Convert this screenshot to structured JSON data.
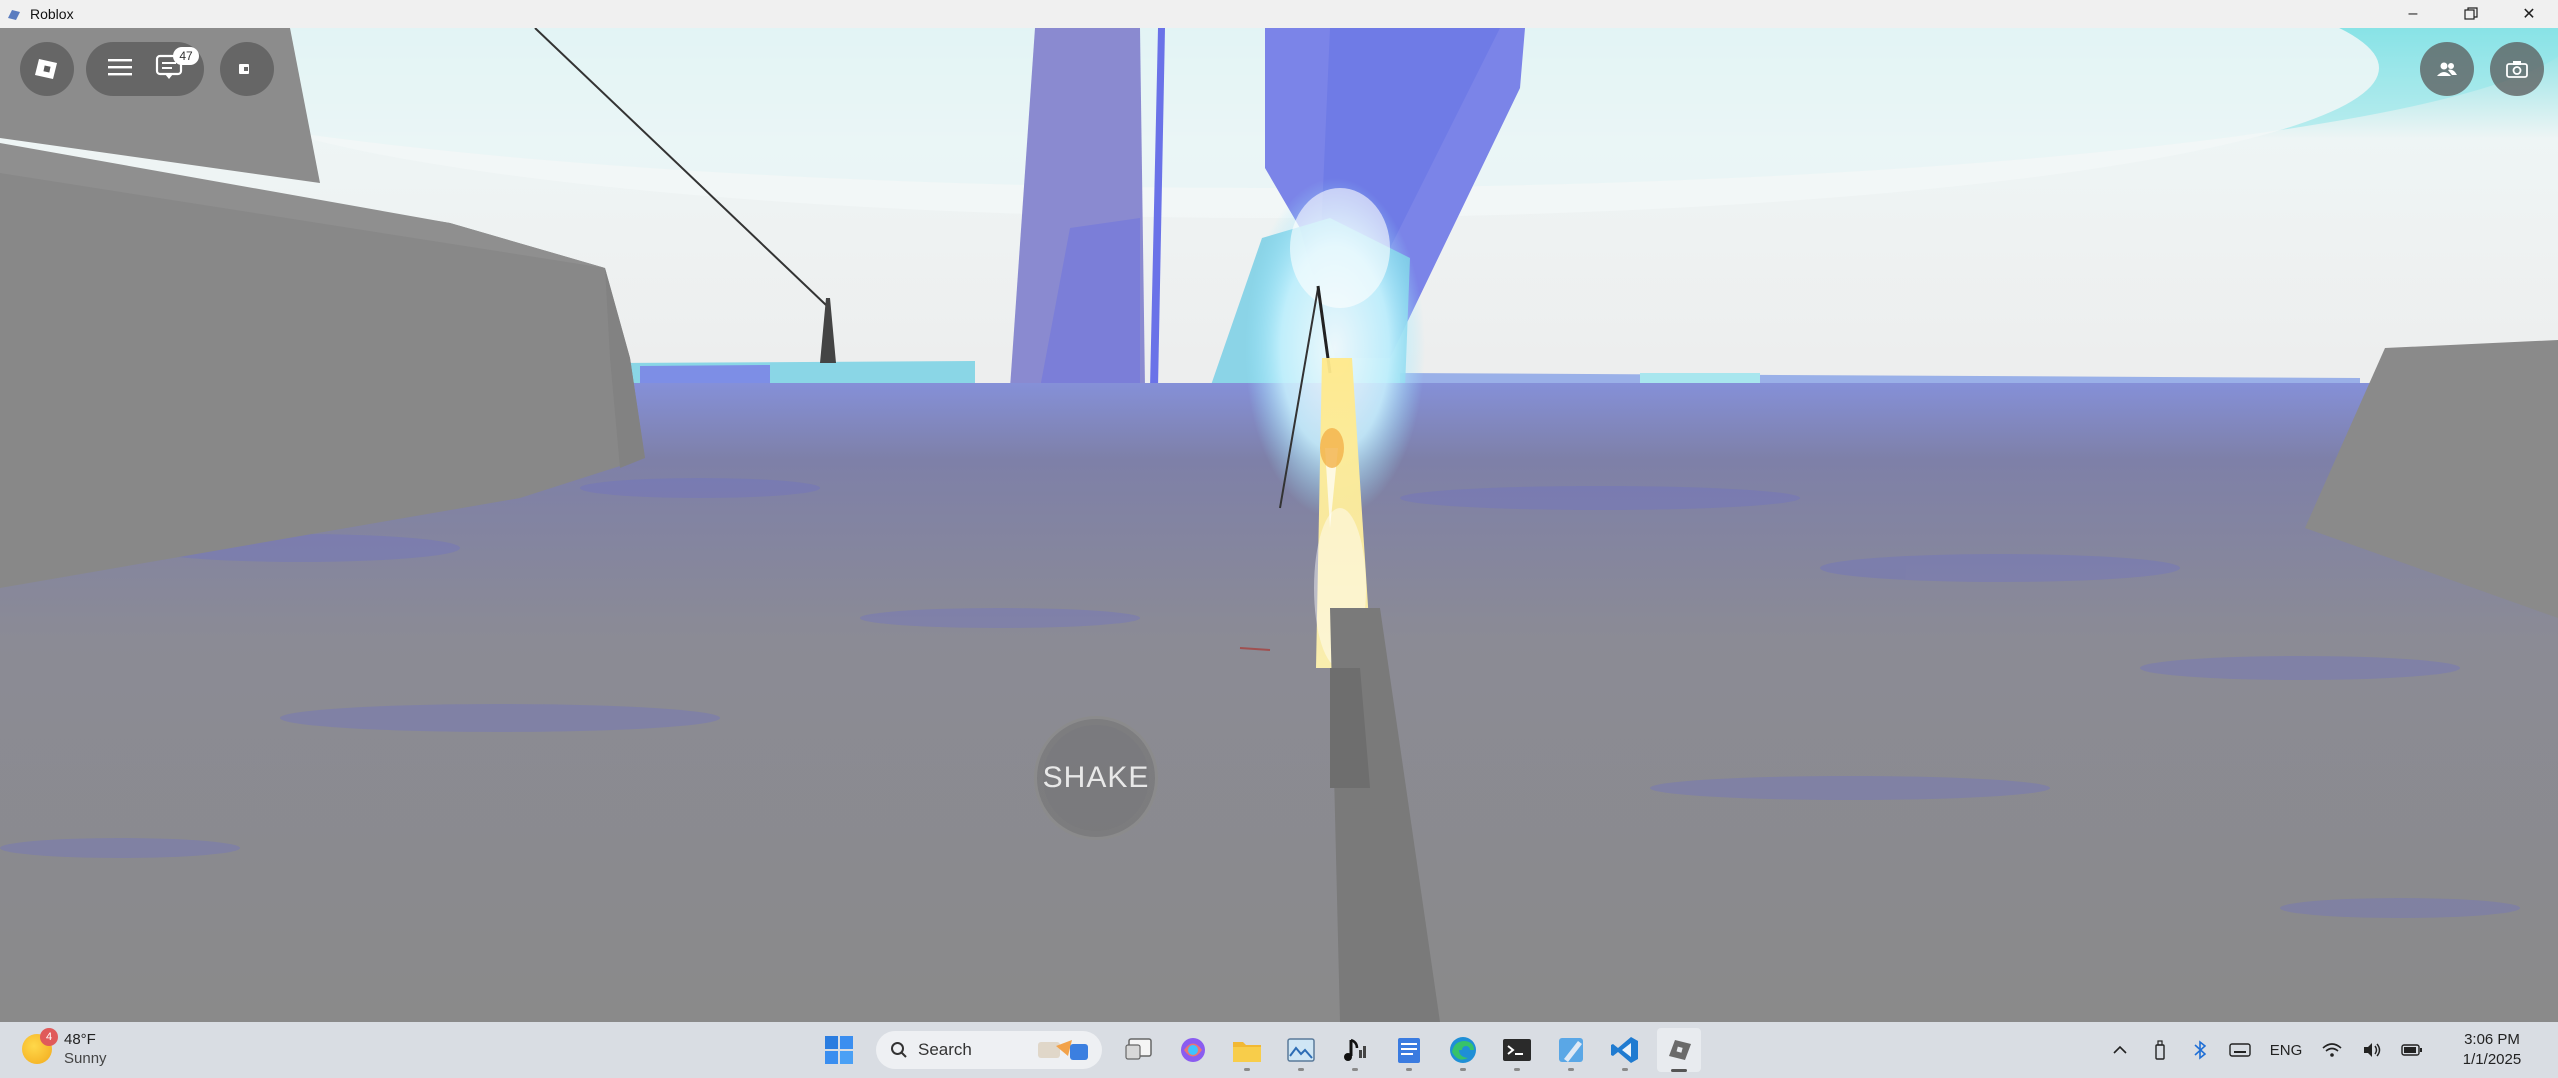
{
  "window": {
    "title": "Roblox",
    "controls": [
      "minimize-icon",
      "restore-icon",
      "close-icon"
    ]
  },
  "hud": {
    "left_buttons": [
      "roblox-menu-icon",
      "hamburger-icon",
      "chat-icon",
      "selfview-icon"
    ],
    "chat_badge": "47",
    "right_buttons": [
      "friends-icon",
      "screenshot-icon"
    ]
  },
  "game": {
    "shake_button": "SHAKE"
  },
  "taskbar": {
    "weather": {
      "badge": "4",
      "temp": "48°F",
      "condition": "Sunny"
    },
    "search_placeholder": "Search",
    "apps": [
      "start-icon",
      "search",
      "task-view-icon",
      "copilot-icon",
      "file-explorer-icon",
      "photos-icon",
      "music-icon",
      "notepad-icon",
      "edge-icon",
      "terminal-icon",
      "paint-icon",
      "vscode-icon",
      "roblox-icon"
    ],
    "tray": {
      "lang": "ENG",
      "time": "3:06 PM",
      "date": "1/1/2025"
    }
  },
  "colors": {
    "sky": "#e9f2f2",
    "sky_glow": "#7fe3e6",
    "water": "#8a8a9a",
    "crystal": "#7f86e6",
    "cliff": "#8c8c8c",
    "taskbar": "#d9dde3"
  }
}
